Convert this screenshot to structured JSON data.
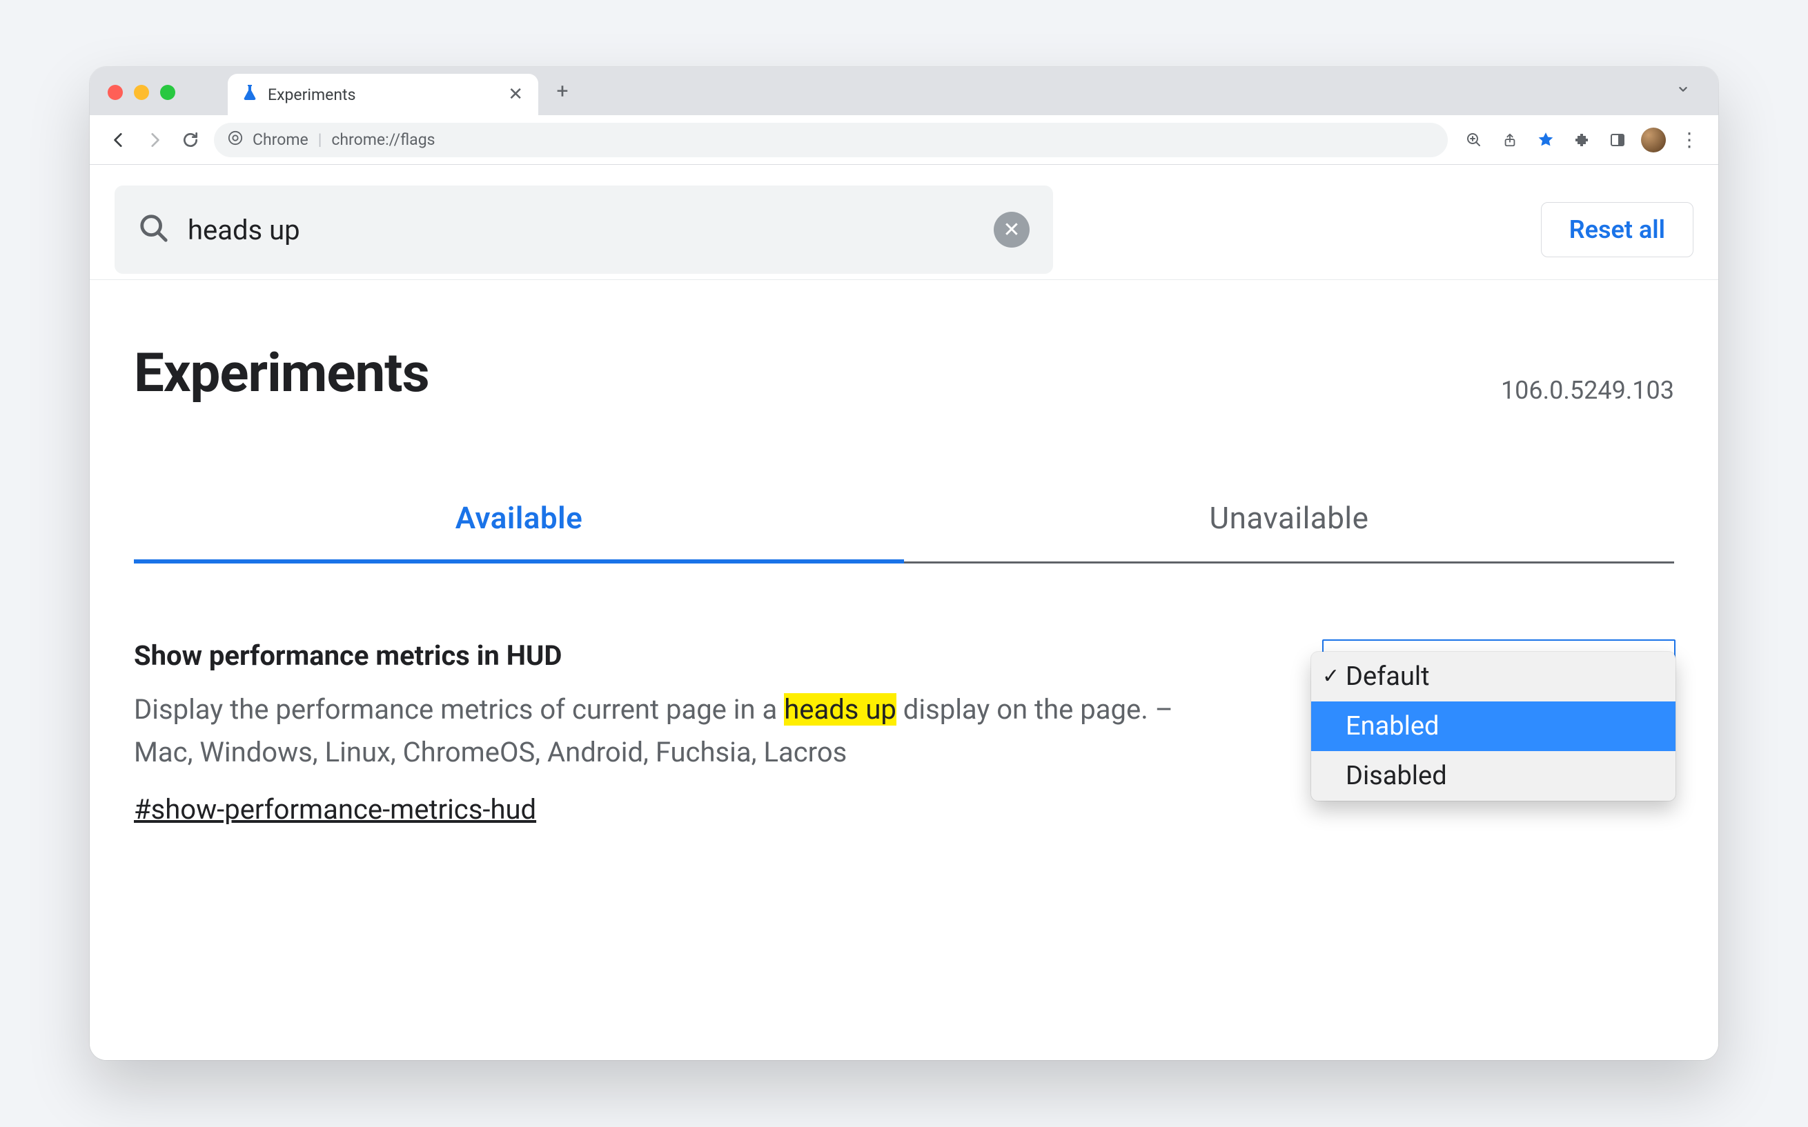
{
  "window": {
    "tab_title": "Experiments",
    "omnibox": {
      "chrome_label": "Chrome",
      "url": "chrome://flags"
    }
  },
  "search": {
    "value": "heads up",
    "reset_label": "Reset all"
  },
  "page": {
    "title": "Experiments",
    "version": "106.0.5249.103",
    "tabs": {
      "available": "Available",
      "unavailable": "Unavailable"
    }
  },
  "flag": {
    "title": "Show performance metrics in HUD",
    "desc_before": "Display the performance metrics of current page in a ",
    "desc_highlight": "heads up",
    "desc_after": " display on the page. – Mac, Windows, Linux, ChromeOS, Android, Fuchsia, Lacros",
    "id": "#show-performance-metrics-hud",
    "dropdown": {
      "options": [
        "Default",
        "Enabled",
        "Disabled"
      ],
      "current": "Default",
      "hovered": "Enabled"
    }
  }
}
